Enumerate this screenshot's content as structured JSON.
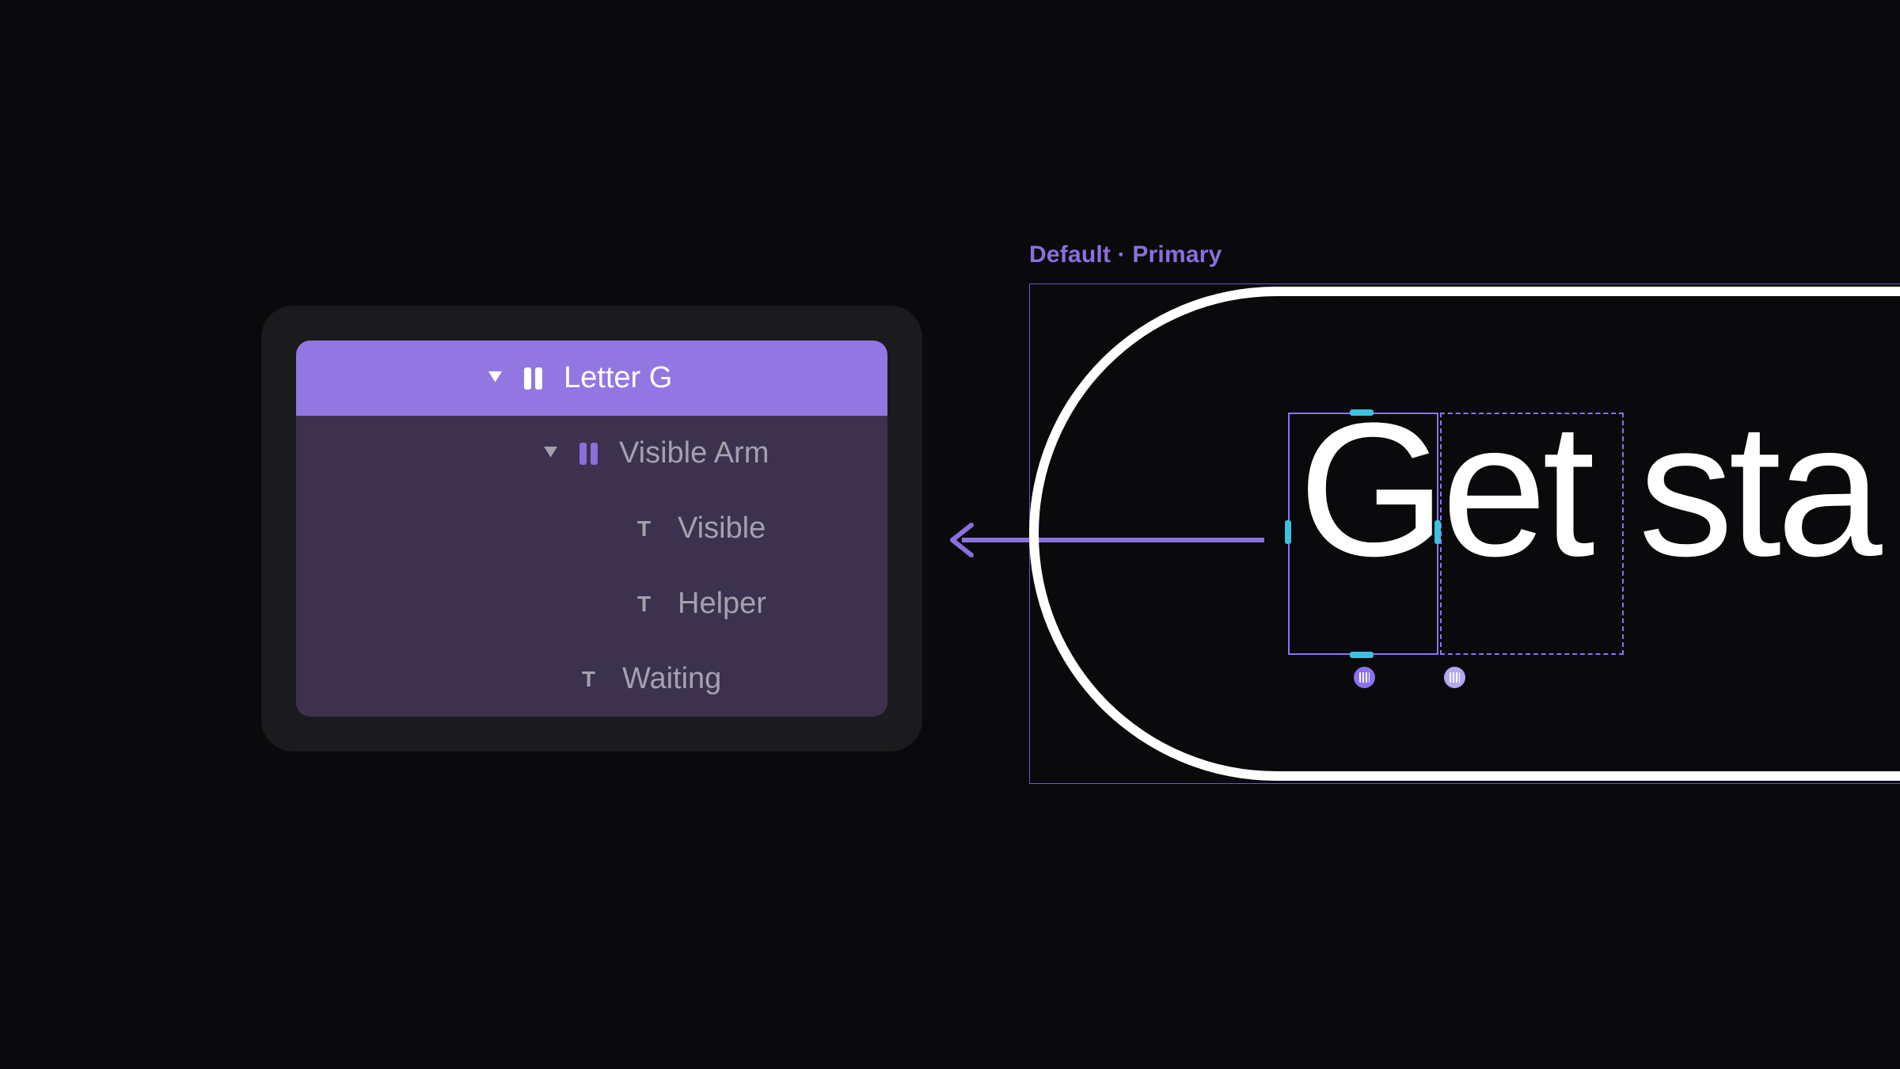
{
  "tree": {
    "items": [
      {
        "label": "Letter G"
      },
      {
        "label": "Visible Arm"
      },
      {
        "label": "Visible"
      },
      {
        "label": "Helper"
      },
      {
        "label": "Waiting"
      }
    ]
  },
  "canvas": {
    "frame_label": "Default · Primary",
    "button_text": "Get sta"
  },
  "colors": {
    "accent": "#8a6fdd",
    "selected": "#9277e2",
    "panel": "#1b1b1d",
    "panel_sub": "#3c324e",
    "selection_handle": "#3dc1e0"
  }
}
